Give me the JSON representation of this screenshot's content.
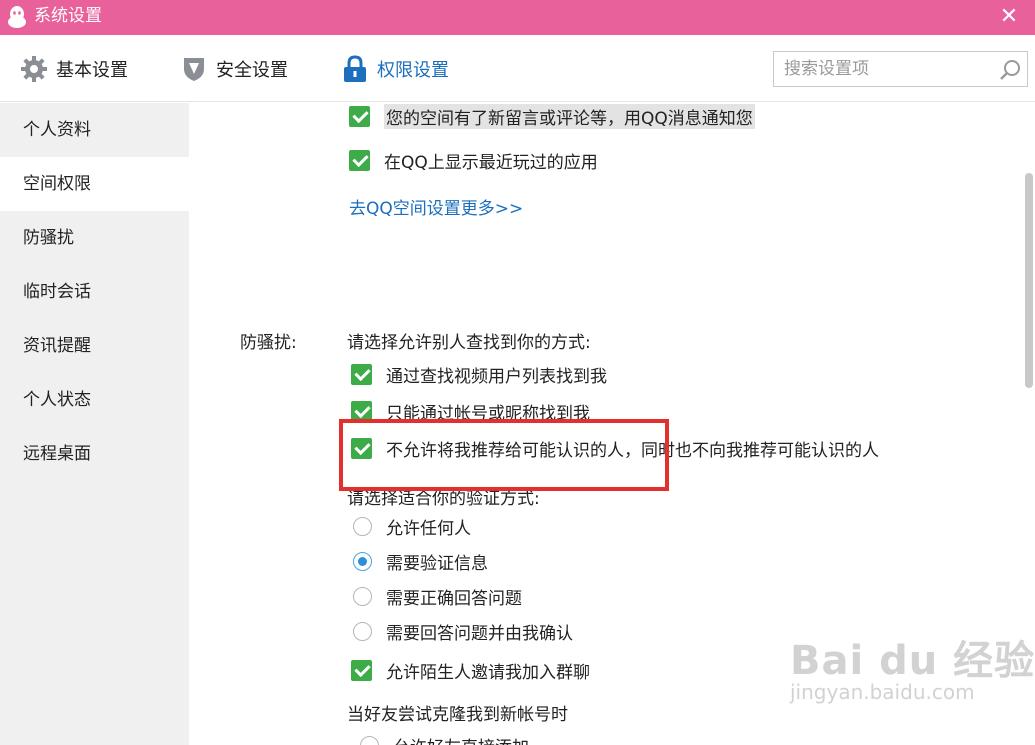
{
  "window": {
    "title": "系统设置",
    "close_glyph": "✕"
  },
  "toolbar": {
    "tabs": [
      {
        "label": "基本设置",
        "icon": "gear-icon"
      },
      {
        "label": "安全设置",
        "icon": "shield-icon"
      },
      {
        "label": "权限设置",
        "icon": "lock-icon",
        "active": true
      }
    ],
    "search_placeholder": "搜索设置项"
  },
  "sidebar": {
    "items": [
      {
        "label": "个人资料"
      },
      {
        "label": "空间权限",
        "active": true
      },
      {
        "label": "防骚扰"
      },
      {
        "label": "临时会话"
      },
      {
        "label": "资讯提醒"
      },
      {
        "label": "个人状态"
      },
      {
        "label": "远程桌面"
      }
    ]
  },
  "space": {
    "notify_label": "您的空间有了新留言或评论等，用QQ消息通知您",
    "show_apps_label": "在QQ上显示最近玩过的应用",
    "more_link": "去QQ空间设置更多>>"
  },
  "harass": {
    "section_label": "防骚扰:",
    "find_prompt": "请选择允许别人查找到你的方式:",
    "find_options": [
      {
        "label": "通过查找视频用户列表找到我",
        "checked": true
      },
      {
        "label": "只能通过帐号或昵称找到我",
        "checked": true
      },
      {
        "label": "不允许将我推荐给可能认识的人，同时也不向我推荐可能认识的人",
        "checked": true
      }
    ],
    "verify_prompt": "请选择适合你的验证方式:",
    "verify_options": [
      {
        "label": "允许任何人",
        "selected": false
      },
      {
        "label": "需要验证信息",
        "selected": true
      },
      {
        "label": "需要正确回答问题",
        "selected": false
      },
      {
        "label": "需要回答问题并由我确认",
        "selected": false
      }
    ],
    "group_invite_label": "允许陌生人邀请我加入群聊",
    "clone_prompt": "当好友尝试克隆我到新帐号时",
    "clone_option_partial": "允许好友直接添加"
  },
  "watermark": {
    "brand": "Bai du 经验",
    "url": "jingyan.baidu.com"
  },
  "colors": {
    "titlebar": "#e9619a",
    "accent": "#1b6fbd",
    "checkbox": "#3dac48",
    "highlight_box": "#e3302f"
  }
}
